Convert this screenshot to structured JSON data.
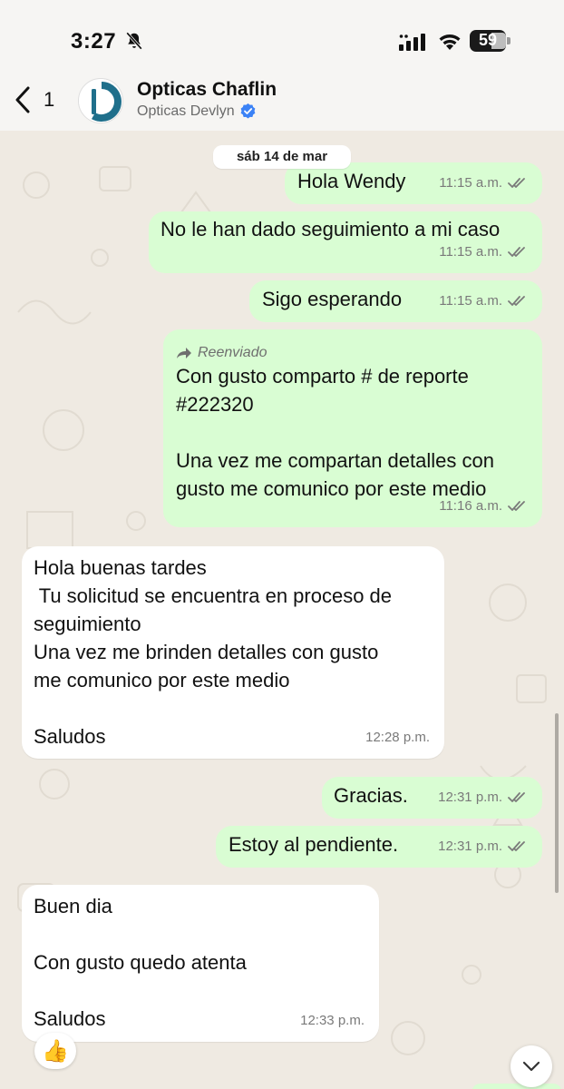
{
  "status_bar": {
    "time": "3:27",
    "battery": "59"
  },
  "header": {
    "back_count": "1",
    "contact_name": "Opticas Chaflin",
    "contact_subtitle": "Opticas Devlyn"
  },
  "chat": {
    "date_chip": "sáb 14 de mar",
    "messages": [
      {
        "direction": "out",
        "text": "Hola Wendy",
        "time": "11:15 a.m.",
        "status": "read"
      },
      {
        "direction": "out",
        "text": "No le han dado seguimiento a mi caso",
        "time": "11:15 a.m.",
        "status": "read"
      },
      {
        "direction": "out",
        "text": "Sigo esperando",
        "time": "11:15 a.m.",
        "status": "read"
      },
      {
        "direction": "out",
        "forwarded_label": "Reenviado",
        "text": "Con gusto comparto # de reporte\n#222320\n\nUna vez me compartan detalles con\ngusto me comunico por este medio",
        "time": "11:16 a.m.",
        "status": "read"
      },
      {
        "direction": "in",
        "text": "Hola buenas tardes\n Tu solicitud se encuentra en proceso de\nseguimiento\nUna vez me brinden detalles con gusto\nme comunico por este medio\n\nSaludos",
        "time": "12:28 p.m."
      },
      {
        "direction": "out",
        "text": "Gracias.",
        "time": "12:31 p.m.",
        "status": "read"
      },
      {
        "direction": "out",
        "text": "Estoy al pendiente.",
        "time": "12:31 p.m.",
        "status": "read"
      },
      {
        "direction": "in",
        "text": "Buen dia\n\nCon gusto quedo atenta\n\nSaludos",
        "time": "12:33 p.m.",
        "reaction": "👍"
      }
    ]
  },
  "colors": {
    "outgoing_bubble": "#d9fdd3",
    "incoming_bubble": "#ffffff",
    "wallpaper": "#efeae2",
    "verified": "#3b82f6",
    "avatar_ring": "#1f6f8b"
  },
  "icons": {
    "mute": "bell-slash-icon",
    "signal": "cellular-signal-icon",
    "wifi": "wifi-icon",
    "battery": "battery-icon",
    "back": "chevron-left-icon",
    "verified": "verified-badge-icon",
    "forward": "forward-arrow-icon",
    "read": "double-check-icon",
    "scroll": "chevron-down-icon"
  }
}
